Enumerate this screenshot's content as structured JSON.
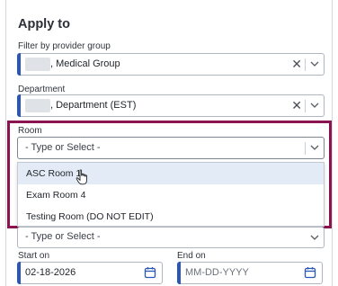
{
  "section_title": "Apply to",
  "provider_group": {
    "label": "Filter by provider group",
    "value": ", Medical Group"
  },
  "department": {
    "label": "Department",
    "value": ", Department (EST)"
  },
  "room": {
    "label": "Room",
    "placeholder": "- Type or Select -",
    "options": [
      "ASC Room 1",
      "Exam Room 4",
      "Testing Room (DO NOT EDIT)"
    ],
    "hovered_option": "ASC Room 1"
  },
  "next_select": {
    "placeholder": "- Type or Select -"
  },
  "start_on": {
    "label": "Start on",
    "value": "02-18-2026"
  },
  "end_on": {
    "label": "End on",
    "placeholder": "MM-DD-YYYY"
  },
  "colors": {
    "accent": "#2a57b5",
    "highlight_border": "#8b1450",
    "calendar_icon": "#2a57b5",
    "option_hover": "#e3ebf6"
  },
  "icons": {
    "clear": "close-icon",
    "dropdown": "chevron-down-icon",
    "calendar": "calendar-icon",
    "pointer": "hand-pointer-icon"
  }
}
